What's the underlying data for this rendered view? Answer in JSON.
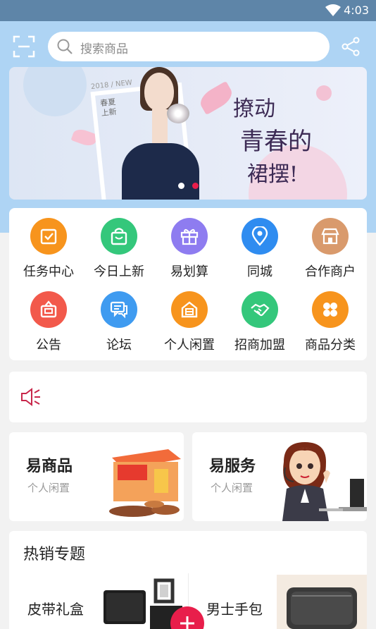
{
  "status": {
    "time": "4:03"
  },
  "search": {
    "placeholder": "搜索商品"
  },
  "banner": {
    "tag_line": "2018 / NEW",
    "small_tag": "春夏\n上新",
    "slogan": [
      "撩动",
      "青春的",
      "裙摆!"
    ],
    "indicators": 2,
    "active_indicator": 1
  },
  "categories": [
    {
      "label": "任务中心",
      "icon": "task-icon",
      "color": "#f7941d"
    },
    {
      "label": "今日上新",
      "icon": "shopping-bag-icon",
      "color": "#34c77b"
    },
    {
      "label": "易划算",
      "icon": "gift-icon",
      "color": "#8e7cf0"
    },
    {
      "label": "同城",
      "icon": "location-pin-icon",
      "color": "#2f8cf0"
    },
    {
      "label": "合作商户",
      "icon": "store-icon",
      "color": "#d99a6c"
    },
    {
      "label": "公告",
      "icon": "announcement-icon",
      "color": "#f2594b"
    },
    {
      "label": "论坛",
      "icon": "forum-icon",
      "color": "#3f9bf0"
    },
    {
      "label": "个人闲置",
      "icon": "idle-item-icon",
      "color": "#f7941d"
    },
    {
      "label": "招商加盟",
      "icon": "handshake-icon",
      "color": "#34c77b"
    },
    {
      "label": "商品分类",
      "icon": "category-grid-icon",
      "color": "#f7941d"
    }
  ],
  "promos": [
    {
      "title": "易商品",
      "subtitle": "个人闲置",
      "image": "snack-gift-box-image"
    },
    {
      "title": "易服务",
      "subtitle": "个人闲置",
      "image": "customer-service-agent-image"
    }
  ],
  "hot": {
    "title": "热销专题",
    "items": [
      {
        "label": "皮带礼盒",
        "image": "wallet-belt-image"
      },
      {
        "label": "男士手包",
        "image": "clutch-bag-image"
      }
    ]
  },
  "colors": {
    "accent": "#e81e4b",
    "header_bg": "#aed4f4",
    "statusbar": "#5e85a8"
  }
}
